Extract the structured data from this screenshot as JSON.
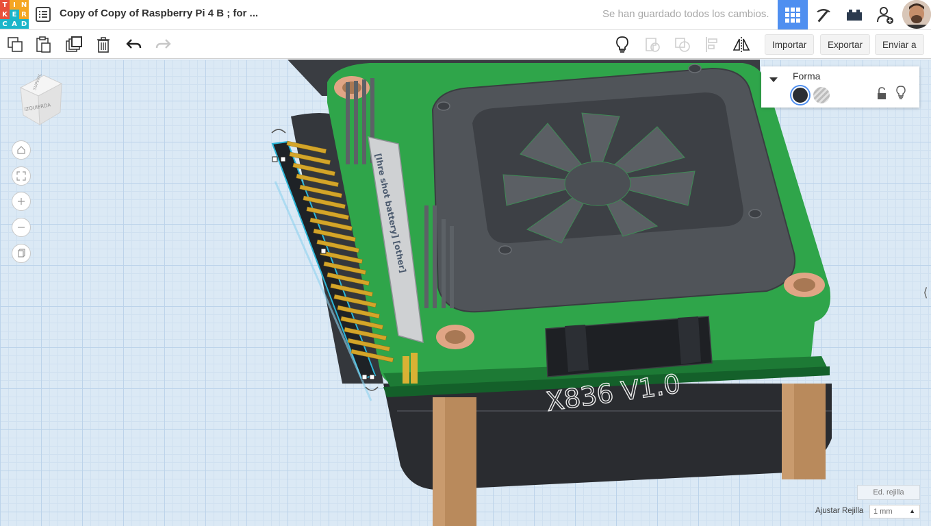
{
  "app": {
    "logo_letters": [
      "T",
      "I",
      "N",
      "K",
      "E",
      "R",
      "C",
      "A",
      "D"
    ],
    "logo_colors": [
      "#e8503a",
      "#f5a623",
      "#f5a623",
      "#e8503a",
      "#1bb5c9",
      "#f5a623",
      "#1bb5c9",
      "#1bb5c9",
      "#1bb5c9"
    ]
  },
  "header": {
    "title": "Copy of Copy of Raspberry Pi 4 B ; for ...",
    "save_status": "Se han guardado todos los cambios."
  },
  "toolbar": {
    "import_label": "Importar",
    "export_label": "Exportar",
    "send_label": "Enviar a"
  },
  "view_cube": {
    "face_front": "IZQUIERDA",
    "face_top": "SUPERIOR"
  },
  "shape_panel": {
    "title": "Forma",
    "solid_color": "#2b2e33"
  },
  "workplane": {
    "board_label": "X836 V1.0",
    "edit_grid_label": "Ed. rejilla",
    "snap_label": "Ajustar Rejilla",
    "snap_value": "1 mm"
  },
  "colors": {
    "accent": "#4f8ff0",
    "pcb_green": "#2fa54a",
    "dark_case": "#2d2f33",
    "grid_bg": "#dbe9f5"
  }
}
